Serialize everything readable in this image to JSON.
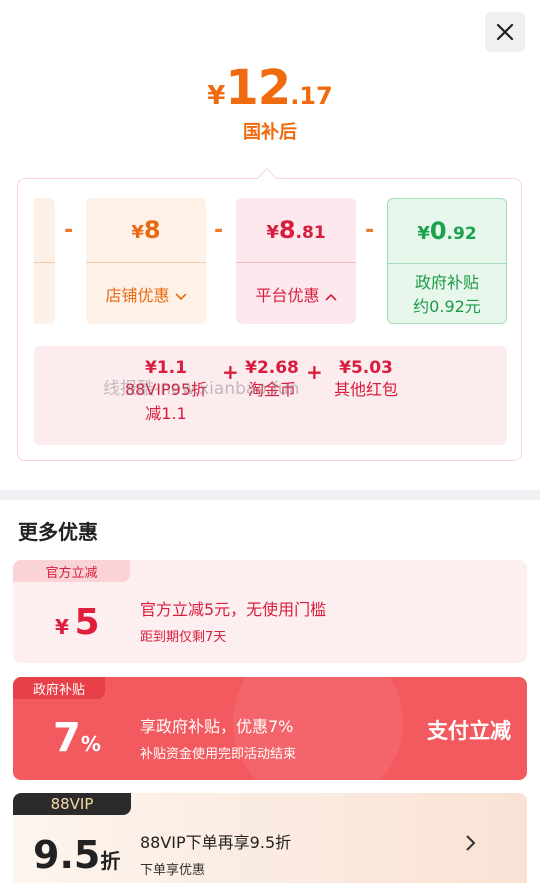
{
  "close": {
    "icon": "close-icon"
  },
  "price": {
    "symbol": "¥",
    "integer": "12",
    "decimal": ".17",
    "label": "国补后"
  },
  "breakdown": {
    "cards": [
      {
        "id": "partial",
        "value_symbol": "",
        "value_int": "",
        "value_dec": "",
        "label": ""
      },
      {
        "id": "shop",
        "value_symbol": "¥",
        "value_int": "8",
        "value_dec": "",
        "label": "店铺优惠",
        "chevron": "chevron-down-icon"
      },
      {
        "id": "platform",
        "value_symbol": "¥",
        "value_int": "8",
        "value_dec": ".81",
        "label": "平台优惠",
        "chevron": "chevron-up-icon"
      },
      {
        "id": "gov",
        "value_symbol": "¥",
        "value_int": "0",
        "value_dec": ".92",
        "label_line1": "政府补贴",
        "label_line2": "约0.92元"
      }
    ],
    "operators": [
      "-",
      "-",
      "-"
    ],
    "platform_detail": [
      {
        "value": "¥1.1",
        "label_line1": "88VIP95折",
        "label_line2": "减1.1"
      },
      {
        "value": "¥2.68",
        "label_line1": "淘金币"
      },
      {
        "value": "¥5.03",
        "label_line1": "其他红包"
      }
    ],
    "plus": [
      "+",
      "+"
    ],
    "watermark": "线报酷-new.xianbao.fun"
  },
  "more": {
    "title": "更多优惠",
    "offers": [
      {
        "tag": "官方立减",
        "symbol": "¥",
        "big": "5",
        "title": "官方立减5元，无使用门槛",
        "sub": "距到期仅剩7天"
      },
      {
        "tag": "政府补贴",
        "big": "7",
        "unit": "%",
        "title": "享政府补贴，优惠7%",
        "sub": "补贴资金使用完即活动结束",
        "action": "支付立减"
      },
      {
        "tag": "88VIP",
        "big": "9.5",
        "unit": "折",
        "title": "88VIP下单再享9.5折",
        "sub": "下单享优惠",
        "chevron": "chevron-right-icon"
      }
    ]
  },
  "colors": {
    "accent_orange": "#f06a0f",
    "accent_red": "#d81e3e",
    "accent_green": "#1aa24c",
    "gov_banner": "#f35a5f"
  }
}
